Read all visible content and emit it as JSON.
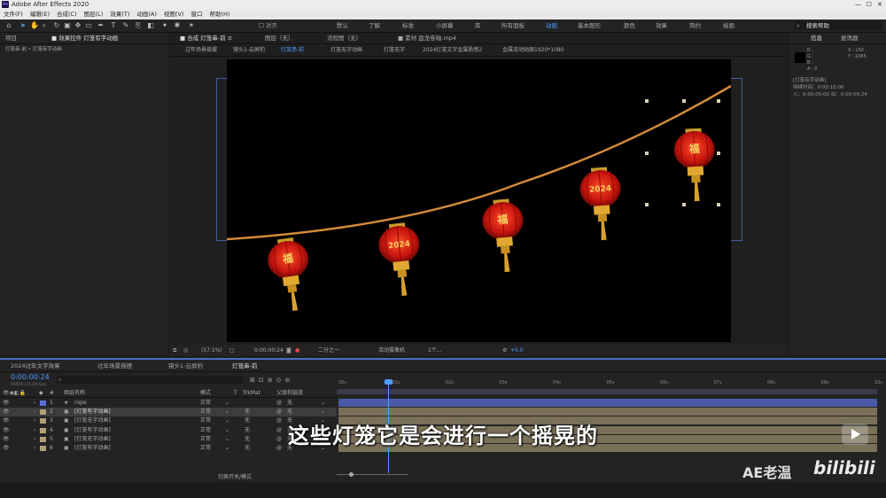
{
  "app": {
    "title": "Adobe After Effects 2020",
    "logo_text": "Ae"
  },
  "menu": [
    "文件(F)",
    "编辑(E)",
    "合成(C)",
    "图层(L)",
    "效果(T)",
    "动画(A)",
    "视图(V)",
    "窗口",
    "帮助(H)"
  ],
  "toolbar": {
    "align_label": "对齐",
    "workspaces": [
      "默认",
      "了解",
      "标准",
      "小屏幕",
      "库",
      "所有面板",
      "动画",
      "基本图形",
      "颜色",
      "效果",
      "简约",
      "绘画"
    ],
    "active_workspace": "动画",
    "search_placeholder": "搜索帮助"
  },
  "project_panel": {
    "tab_project": "项目",
    "tab_effects": "效果控件 灯笼有字动画",
    "breadcrumb": "灯笼串-前 • 灯笼有字动画"
  },
  "comp_panel": {
    "tab_comp": "合成 灯笼串-前",
    "tab_layer": "图层（无）",
    "tab_flow": "流程图（无）",
    "tab_footage": "素材 盘龙卷轴.mp4",
    "flow_tabs": [
      "过年场景摇摆",
      "镜头1-云屏豹",
      "灯笼串-前",
      "灯笼无字动画",
      "灯笼无字",
      "2024灯笼文字金属质感2",
      "金属流动贴图1920*1080"
    ],
    "active_flow_tab": "灯笼串-前",
    "zoom": "(57.1%)",
    "timecode": "0:00:00:24",
    "resolution": "二分之一",
    "camera": "活动摄像机",
    "views": "1个...",
    "exposure": "+0.0",
    "lantern_chars": [
      "福",
      "2024",
      "福",
      "2024",
      "福"
    ]
  },
  "info_panel": {
    "tab_info": "信息",
    "tab_align": "振荡器",
    "r": "R :",
    "g": "G :",
    "b": "B :",
    "a": "A : 0",
    "x": "X : 150",
    "y": "Y : 1085",
    "layer_name": "[灯笼有字动画]",
    "duration": "持续时间：0:00:10:00",
    "in_point": "入：0:00:00:00",
    "out_point": "出：0:00:09:24"
  },
  "timeline": {
    "tabs": [
      "2024过年文字效果",
      "过年场景摇摆",
      "镜头1-云屏豹",
      "灯笼串-前"
    ],
    "active_tab": "灯笼串-前",
    "timecode": "0:00:00:24",
    "frame_info": "00024 (25.00 fps)",
    "search_placeholder": "",
    "col_name": "图层名称",
    "col_mode": "模式",
    "col_t": "T",
    "col_trkmat": "TrkMat",
    "col_parent": "父级和链接",
    "ruler": [
      "00s",
      "01s",
      "02s",
      "03s",
      "04s",
      "05s",
      "06s",
      "07s",
      "08s",
      "09s",
      "10s"
    ],
    "layers": [
      {
        "num": "1",
        "name": "rope",
        "mode": "正常",
        "trkmat": "",
        "parent": "无",
        "color": "#5a6fd6",
        "type": "★"
      },
      {
        "num": "2",
        "name": "[灯笼有字动画]",
        "mode": "正常",
        "trkmat": "无",
        "parent": "无",
        "color": "#b0a07a",
        "type": "▣"
      },
      {
        "num": "3",
        "name": "[灯笼无字动画]",
        "mode": "正常",
        "trkmat": "无",
        "parent": "无",
        "color": "#b0a07a",
        "type": "▣"
      },
      {
        "num": "4",
        "name": "[灯笼有字动画]",
        "mode": "正常",
        "trkmat": "无",
        "parent": "无",
        "color": "#b0a07a",
        "type": "▣"
      },
      {
        "num": "5",
        "name": "[灯笼无字动画]",
        "mode": "正常",
        "trkmat": "无",
        "parent": "无",
        "color": "#b0a07a",
        "type": "▣"
      },
      {
        "num": "6",
        "name": "[灯笼有字动画]",
        "mode": "正常",
        "trkmat": "无",
        "parent": "无",
        "color": "#b0a07a",
        "type": "▣"
      }
    ],
    "toggle_label": "切换开关/模式"
  },
  "subtitle": "这些灯笼它是会进行一个摇晃的",
  "watermark": {
    "left": "AE老温",
    "right": "bilibili"
  }
}
